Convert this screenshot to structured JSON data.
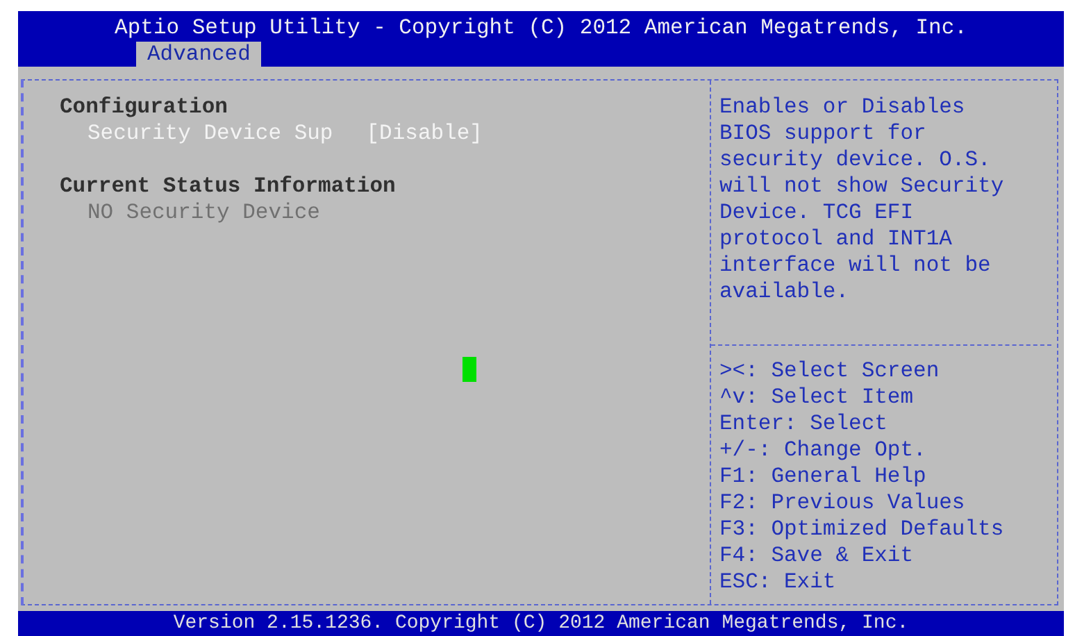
{
  "header": {
    "title": "Aptio Setup Utility - Copyright (C) 2012 American Megatrends, Inc."
  },
  "tabs": [
    {
      "label": "Advanced",
      "selected": true
    }
  ],
  "items": [
    {
      "kind": "heading",
      "text": "Configuration"
    },
    {
      "kind": "option",
      "label": "Security Device Sup",
      "value": "[Disable]",
      "selected": true
    },
    {
      "kind": "heading",
      "text": "Current Status Information"
    },
    {
      "kind": "info",
      "text": "NO Security Device"
    }
  ],
  "help": {
    "description": "Enables or Disables BIOS support for security device. O.S. will not show Security Device. TCG EFI protocol and INT1A interface will not be available.",
    "keys": [
      "><: Select Screen",
      "^v: Select Item",
      "Enter: Select",
      "+/-: Change Opt.",
      "F1: General Help",
      "F2: Previous Values",
      "F3: Optimized Defaults",
      "F4: Save & Exit",
      "ESC: Exit"
    ]
  },
  "footer": {
    "text": "Version 2.15.1236. Copyright (C) 2012 American Megatrends, Inc."
  }
}
